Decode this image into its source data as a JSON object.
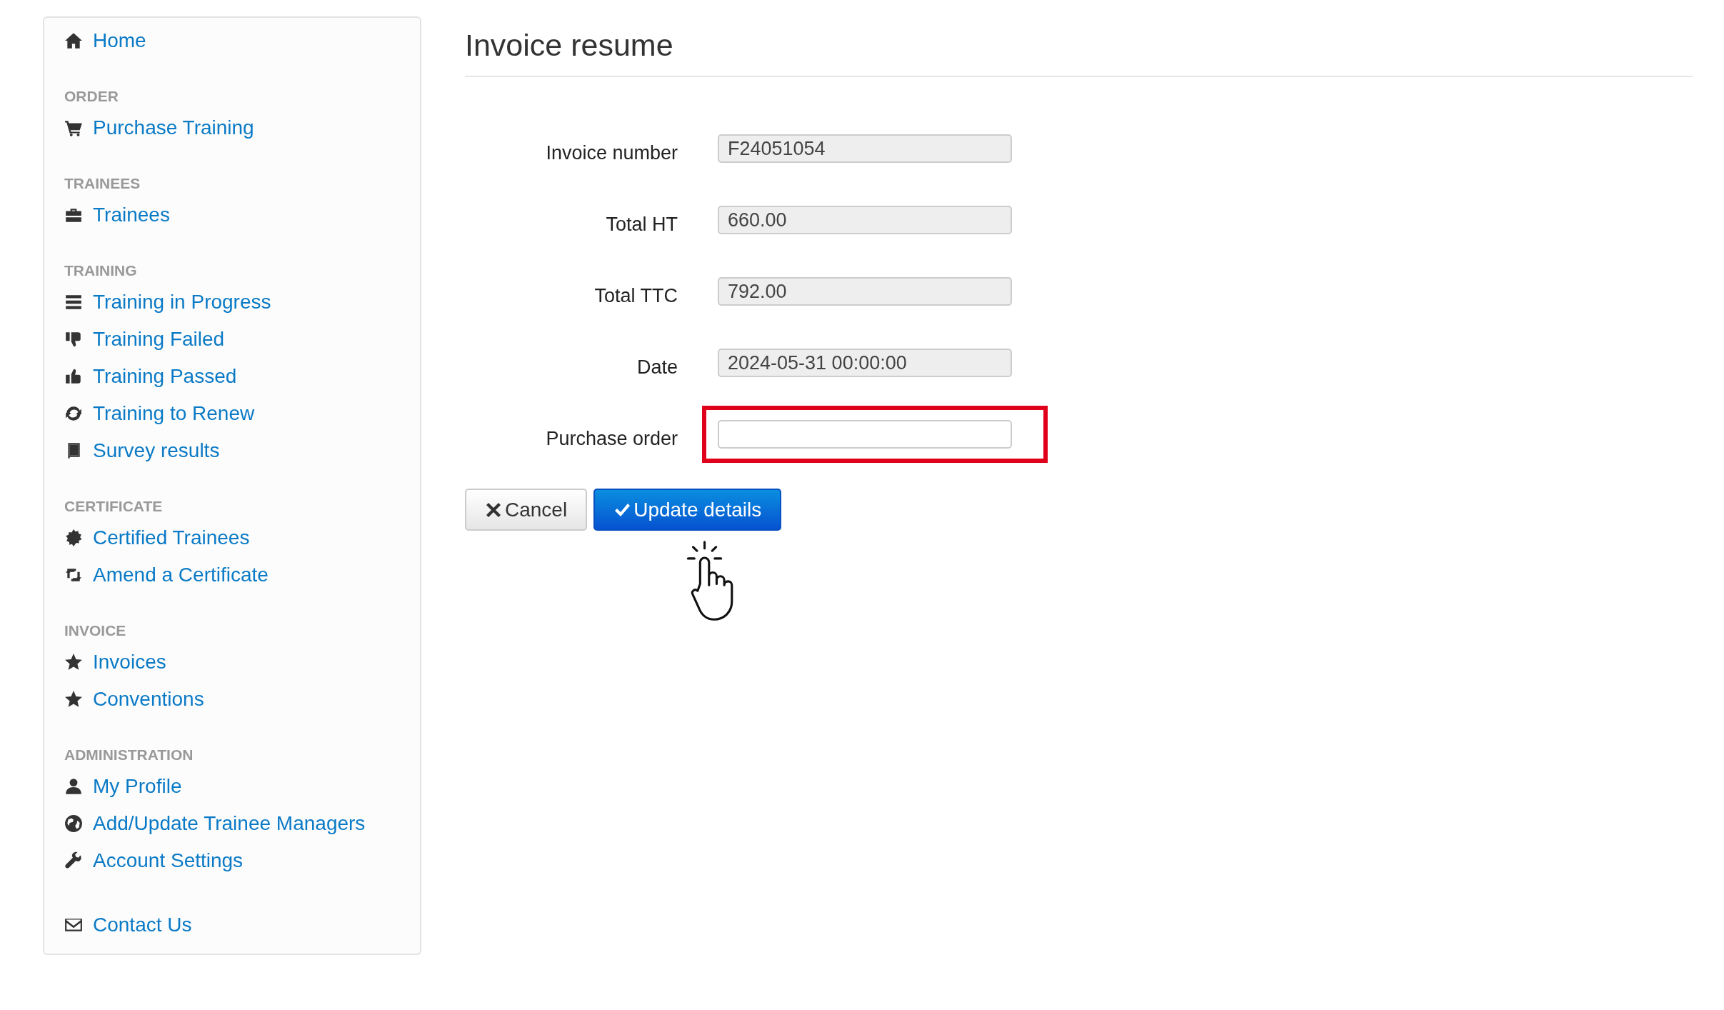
{
  "sidebar": {
    "groups": [
      {
        "items": [
          {
            "label": "Home"
          }
        ]
      },
      {
        "title": "ORDER",
        "items": [
          {
            "label": "Purchase Training"
          }
        ]
      },
      {
        "title": "TRAINEES",
        "items": [
          {
            "label": "Trainees"
          }
        ]
      },
      {
        "title": "TRAINING",
        "items": [
          {
            "label": "Training in Progress"
          },
          {
            "label": "Training Failed"
          },
          {
            "label": "Training Passed"
          },
          {
            "label": "Training to Renew"
          },
          {
            "label": "Survey results"
          }
        ]
      },
      {
        "title": "CERTIFICATE",
        "items": [
          {
            "label": "Certified Trainees"
          },
          {
            "label": "Amend a Certificate"
          }
        ]
      },
      {
        "title": "INVOICE",
        "items": [
          {
            "label": "Invoices"
          },
          {
            "label": "Conventions"
          }
        ]
      },
      {
        "title": "ADMINISTRATION",
        "items": [
          {
            "label": "My Profile"
          },
          {
            "label": "Add/Update Trainee Managers"
          },
          {
            "label": "Account Settings"
          }
        ]
      },
      {
        "items": [
          {
            "label": "Contact Us"
          }
        ]
      }
    ]
  },
  "page": {
    "title": "Invoice resume"
  },
  "form": {
    "fields": [
      {
        "label": "Invoice number",
        "value": "F24051054",
        "readonly": true,
        "highlighted": false
      },
      {
        "label": "Total HT",
        "value": "660.00",
        "readonly": true,
        "highlighted": false
      },
      {
        "label": "Total TTC",
        "value": "792.00",
        "readonly": true,
        "highlighted": false
      },
      {
        "label": "Date",
        "value": "2024-05-31 00:00:00",
        "readonly": true,
        "highlighted": false
      },
      {
        "label": "Purchase order",
        "readonly": false,
        "highlighted": true
      }
    ],
    "buttons": [
      {
        "label": "Cancel",
        "kind": "cancel"
      },
      {
        "label": "Update details",
        "kind": "primary"
      }
    ]
  }
}
